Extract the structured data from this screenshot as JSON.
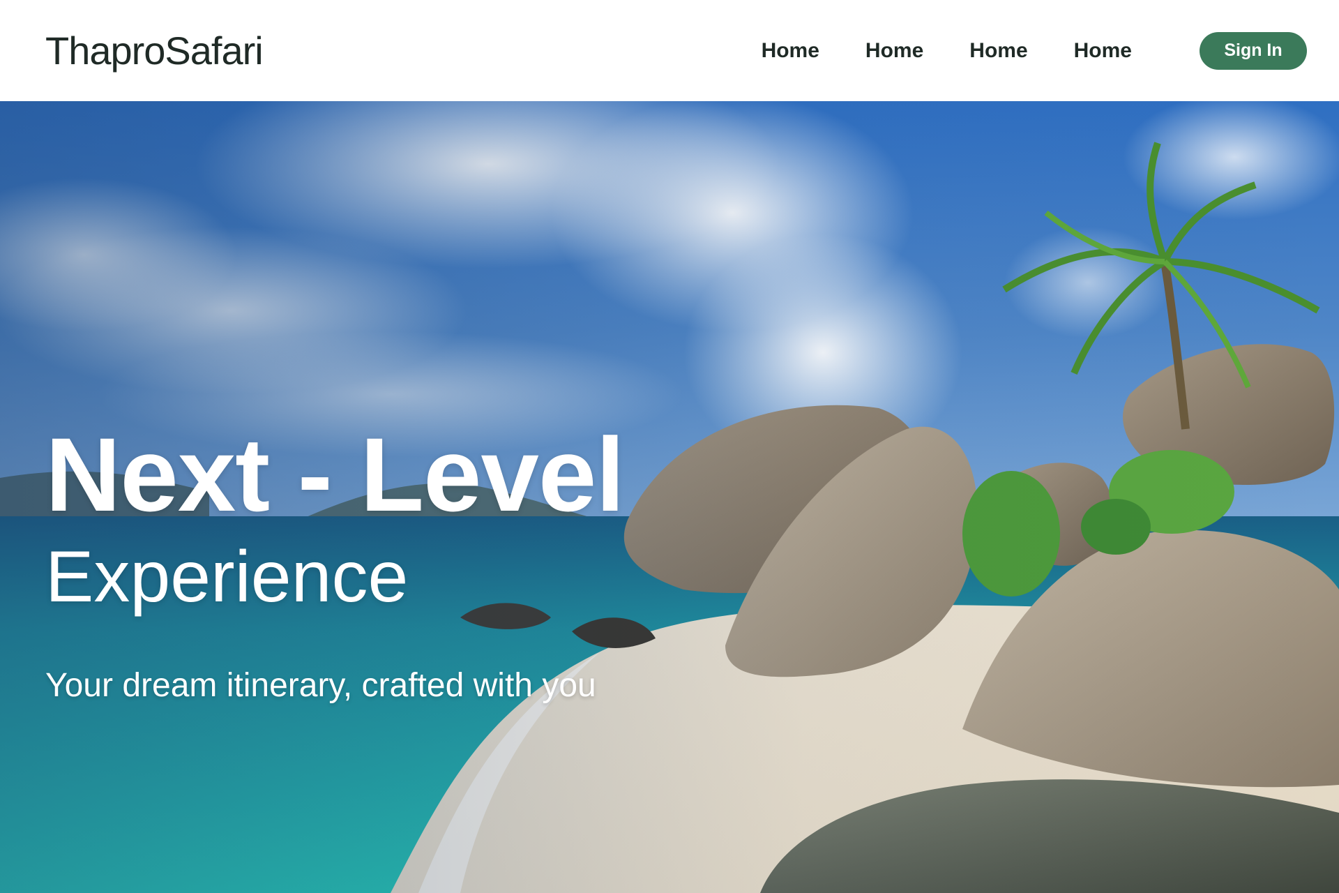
{
  "brand": {
    "name": "ThaproSafari"
  },
  "nav": {
    "links": [
      "Home",
      "Home",
      "Home",
      "Home"
    ],
    "signin_label": "Sign In"
  },
  "hero": {
    "headline": "Next - Level",
    "subheadline": "Experience",
    "tagline": "Your dream itinerary, crafted with you",
    "image_subject": "tropical beach with granite boulders and palm tree"
  },
  "colors": {
    "accent": "#3b7a5a",
    "nav_text": "#1f2a26",
    "hero_text": "#ffffff"
  }
}
